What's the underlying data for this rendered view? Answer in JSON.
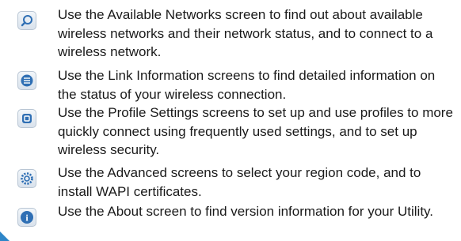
{
  "help_items": [
    {
      "icon": "search-icon",
      "text": "Use the Available Networks screen to find out about available wireless networks and their network status, and to connect to a wireless network."
    },
    {
      "icon": "list-icon",
      "text": "Use the Link Information screens to find detailed information on the status of your wireless connection."
    },
    {
      "icon": "profile-icon",
      "text": "Use the Profile Settings screens to set up and use profiles to more quickly connect using frequently used settings, and to set up wireless security."
    },
    {
      "icon": "gear-icon",
      "text": "Use the Advanced screens to select your region code, and to install WAPI certificates."
    },
    {
      "icon": "info-icon",
      "text": "Use the About screen to find version information for your Utility."
    }
  ],
  "colors": {
    "icon_blue": "#2f6fb4",
    "pointer_blue": "#2e86c8"
  }
}
